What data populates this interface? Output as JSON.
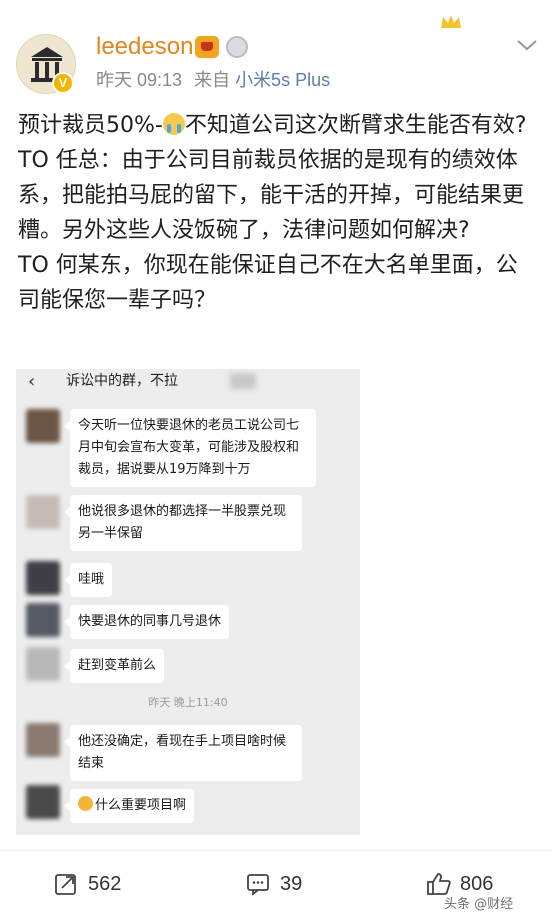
{
  "header": {
    "username": "leedeson",
    "time": "昨天 09:13",
    "source_prefix": "来自",
    "device": "小米5s Plus",
    "avatar_badge": "V"
  },
  "post": {
    "paragraphs": [
      {
        "before_emoji": "预计裁员50%-",
        "after_emoji": "不知道公司这次断臂求生能否有效?"
      },
      {
        "text": "TO  任总：由于公司目前裁员依据的是现有的绩效体系，把能拍马屁的留下，能干活的开掉，可能结果更糟。另外这些人没饭碗了，法律问题如何解决?"
      },
      {
        "text": "TO 何某东，你现在能保证自己不在大名单里面，公司能保您一辈子吗？"
      }
    ]
  },
  "chat": {
    "back_glyph": "‹",
    "title": "诉讼中的群，不拉",
    "timestamp": "昨天 晚上11:40",
    "messages": [
      {
        "text": "今天听一位快要退休的老员工说公司七月中旬会宣布大变革，可能涉及股权和裁员，据说要从19万降到十万"
      },
      {
        "text": "他说很多退休的都选择一半股票兑现另一半保留"
      },
      {
        "text": "哇哦"
      },
      {
        "text": "快要退休的同事几号退休"
      },
      {
        "text": "赶到变革前么"
      },
      {
        "text": "他还没确定，看现在手上项目啥时候结束"
      },
      {
        "text": "什么重要项目啊"
      }
    ]
  },
  "actions": {
    "repost_count": "562",
    "comment_count": "39",
    "like_count": "806"
  },
  "watermark": "头条 @财经",
  "colors": {
    "username": "#e0861d",
    "device_link": "#5c7fab",
    "chat_bg": "#ededed"
  }
}
